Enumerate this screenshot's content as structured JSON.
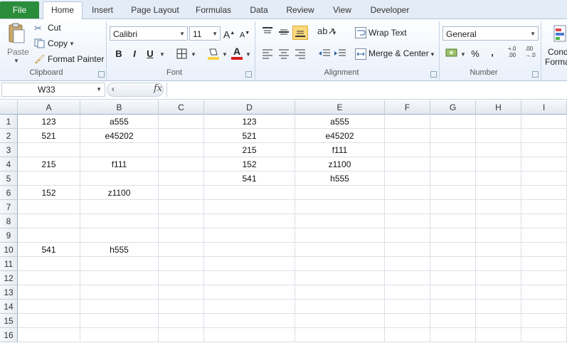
{
  "tabs": {
    "file": "File",
    "home": "Home",
    "insert": "Insert",
    "page_layout": "Page Layout",
    "formulas": "Formulas",
    "data": "Data",
    "review": "Review",
    "view": "View",
    "developer": "Developer"
  },
  "clipboard": {
    "paste": "Paste",
    "cut": "Cut",
    "copy": "Copy",
    "format_painter": "Format Painter",
    "label": "Clipboard"
  },
  "font": {
    "name": "Calibri",
    "size": "11",
    "bold": "B",
    "italic": "I",
    "underline": "U",
    "label": "Font"
  },
  "alignment": {
    "wrap_text": "Wrap Text",
    "merge_center": "Merge & Center",
    "label": "Alignment"
  },
  "number": {
    "format": "General",
    "percent": "%",
    "comma": ",",
    "inc_decimal": "+.0\n.00",
    "label": "Number"
  },
  "styles": {
    "conditional_line1": "Cond",
    "conditional_line2": "Forma"
  },
  "formula_bar": {
    "name_box": "W33",
    "fx": "fx",
    "value": ""
  },
  "columns": [
    "A",
    "B",
    "C",
    "D",
    "E",
    "F",
    "G",
    "H",
    "I"
  ],
  "rows": [
    "1",
    "2",
    "3",
    "4",
    "5",
    "6",
    "7",
    "8",
    "9",
    "10",
    "11",
    "12",
    "13",
    "14",
    "15",
    "16"
  ],
  "cells": [
    [
      "123",
      "a555",
      "",
      "123",
      "a555",
      "",
      "",
      "",
      ""
    ],
    [
      "521",
      "e45202",
      "",
      "521",
      "e45202",
      "",
      "",
      "",
      ""
    ],
    [
      "",
      "",
      "",
      "215",
      "f111",
      "",
      "",
      "",
      ""
    ],
    [
      "215",
      "f111",
      "",
      "152",
      "z1100",
      "",
      "",
      "",
      ""
    ],
    [
      "",
      "",
      "",
      "541",
      "h555",
      "",
      "",
      "",
      ""
    ],
    [
      "152",
      "z1100",
      "",
      "",
      "",
      "",
      "",
      "",
      ""
    ],
    [
      "",
      "",
      "",
      "",
      "",
      "",
      "",
      "",
      ""
    ],
    [
      "",
      "",
      "",
      "",
      "",
      "",
      "",
      "",
      ""
    ],
    [
      "",
      "",
      "",
      "",
      "",
      "",
      "",
      "",
      ""
    ],
    [
      "541",
      "h555",
      "",
      "",
      "",
      "",
      "",
      "",
      ""
    ],
    [
      "",
      "",
      "",
      "",
      "",
      "",
      "",
      "",
      ""
    ],
    [
      "",
      "",
      "",
      "",
      "",
      "",
      "",
      "",
      ""
    ],
    [
      "",
      "",
      "",
      "",
      "",
      "",
      "",
      "",
      ""
    ],
    [
      "",
      "",
      "",
      "",
      "",
      "",
      "",
      "",
      ""
    ],
    [
      "",
      "",
      "",
      "",
      "",
      "",
      "",
      "",
      ""
    ],
    [
      "",
      "",
      "",
      "",
      "",
      "",
      "",
      "",
      ""
    ]
  ],
  "colors": {
    "file_tab": "#2a8d3c",
    "highlight_yellow": "#f7d244",
    "font_red": "#d81e1e"
  }
}
